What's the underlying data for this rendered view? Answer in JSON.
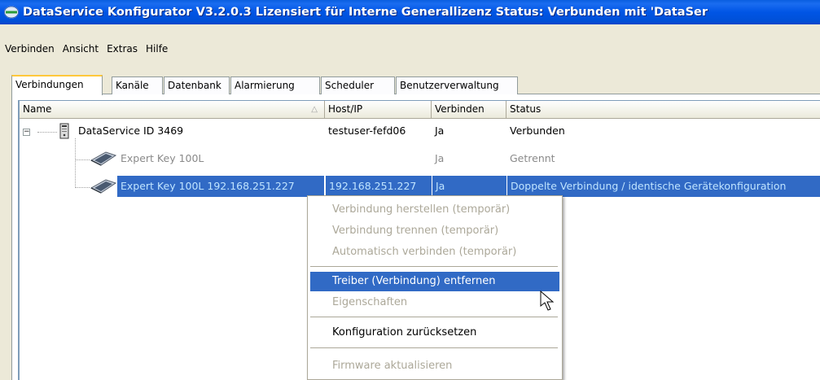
{
  "window": {
    "title": "DataService Konfigurator V3.2.0.3  Lizensiert für Interne Generallizenz   Status: Verbunden mit 'DataSer",
    "icon": "app-icon"
  },
  "menu": {
    "items": [
      "Verbinden",
      "Ansicht",
      "Extras",
      "Hilfe"
    ]
  },
  "tabs": [
    {
      "label": "Verbindungen",
      "active": true
    },
    {
      "label": "Kanäle"
    },
    {
      "label": "Datenbank"
    },
    {
      "label": "Alarmierung"
    },
    {
      "label": "Scheduler"
    },
    {
      "label": "Benutzerverwaltung"
    }
  ],
  "table": {
    "columns": [
      "Name",
      "Host/IP",
      "Verbinden",
      "Status"
    ],
    "rows": [
      {
        "name": "DataService ID 3469",
        "host": "testuser-fefd06",
        "connect": "Ja",
        "status": "Verbunden",
        "icon": "server-icon",
        "state": "normal"
      },
      {
        "name": "Expert Key 100L",
        "host": "",
        "connect": "Ja",
        "status": "Getrennt",
        "icon": "device-icon",
        "state": "disabled"
      },
      {
        "name": "Expert Key 100L 192.168.251.227",
        "host": "192.168.251.227",
        "connect": "Ja",
        "status": "Doppelte Verbindung / identische Gerätekonfiguration",
        "icon": "device-icon",
        "state": "selected"
      }
    ]
  },
  "context_menu": {
    "items": [
      {
        "label": "Verbindung herstellen (temporär)",
        "enabled": false
      },
      {
        "label": "Verbindung trennen (temporär)",
        "enabled": false
      },
      {
        "label": "Automatisch verbinden (temporär)",
        "enabled": false
      },
      {
        "label": "Treiber (Verbindung) entfernen",
        "enabled": true,
        "highlighted": true
      },
      {
        "label": "Eigenschaften",
        "enabled": false
      },
      {
        "label": "Konfiguration zurücksetzen",
        "enabled": true
      },
      {
        "label": "Firmware aktualisieren",
        "enabled": false
      }
    ]
  },
  "colors": {
    "selection": "#316ac5",
    "selected_text": "#bfe4ff",
    "disabled_text": "#8a8a8a",
    "title_bar": "#0055e5"
  }
}
